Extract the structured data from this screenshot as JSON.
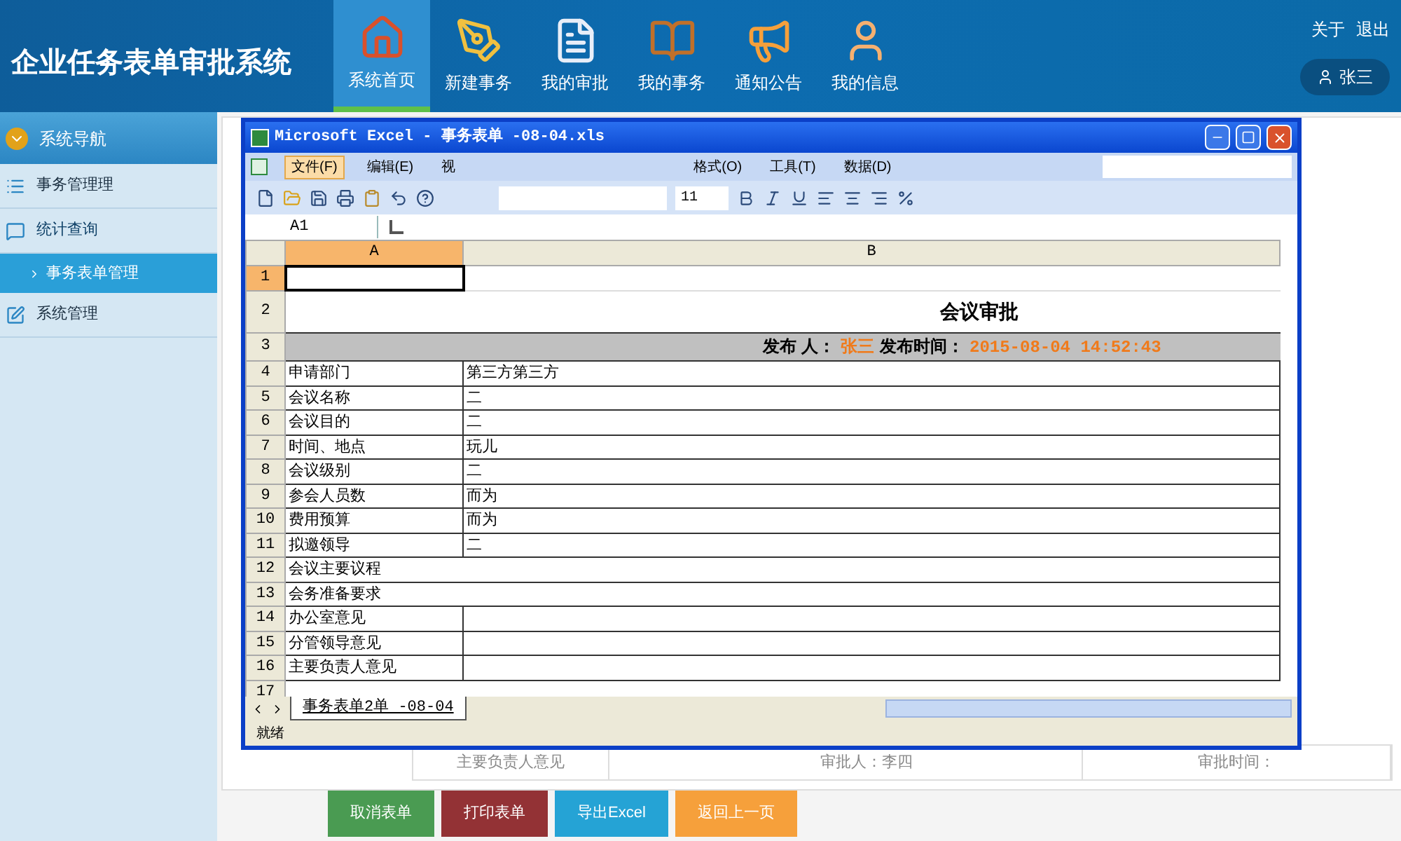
{
  "header": {
    "title": "企业任务表单审批系统",
    "nav": [
      {
        "label": "系统首页",
        "selected": true,
        "kind": "house"
      },
      {
        "label": "新建事务",
        "selected": false,
        "kind": "pencil"
      },
      {
        "label": "我的审批",
        "selected": false,
        "kind": "document"
      },
      {
        "label": "我的事务",
        "selected": false,
        "kind": "book"
      },
      {
        "label": "通知公告",
        "selected": false,
        "kind": "megaphone"
      },
      {
        "label": "我的信息",
        "selected": false,
        "kind": "person"
      }
    ],
    "links": [
      "关于",
      "退出"
    ],
    "user": "张三"
  },
  "sidebar": {
    "heading": "系统导航",
    "items": [
      {
        "label": "事务管理理",
        "kind": "list",
        "expanded": false
      },
      {
        "label": "统计查询",
        "kind": "chat",
        "expanded": true,
        "children": [
          {
            "label": "事务表单管理",
            "selected": true
          }
        ]
      },
      {
        "label": "系统管理",
        "kind": "edit",
        "expanded": false
      }
    ]
  },
  "excel": {
    "title": "Microsoft Excel - 事务表单   -08-04.xls",
    "menu": [
      {
        "label": "文件(F)",
        "selected": true
      },
      {
        "label": "编辑(E)",
        "selected": false
      },
      {
        "label": "视",
        "selected": false
      },
      {
        "label": "格式(O)",
        "selected": false
      },
      {
        "label": "工具(T)",
        "selected": false
      },
      {
        "label": "数据(D)",
        "selected": false
      }
    ],
    "font_size": "11",
    "name_box": "A1",
    "columns": [
      "A",
      "B"
    ],
    "rows": [
      {
        "n": "1",
        "kind": "blank",
        "selected": true
      },
      {
        "n": "2",
        "kind": "title",
        "text": "会议审批"
      },
      {
        "n": "3",
        "kind": "meta",
        "parts": [
          {
            "text": "发布 人：",
            "kind": "label"
          },
          {
            "text": "张三",
            "kind": "value"
          },
          {
            "text": "发布时间：",
            "kind": "label"
          },
          {
            "text": "2015-08-04 14:52:43",
            "kind": "value"
          }
        ]
      },
      {
        "n": "4",
        "kind": "pair",
        "a": "申请部门",
        "b": "第三方第三方"
      },
      {
        "n": "5",
        "kind": "pair",
        "a": "会议名称",
        "b": "二"
      },
      {
        "n": "6",
        "kind": "pair",
        "a": "会议目的",
        "b": "二"
      },
      {
        "n": "7",
        "kind": "pair",
        "a": "时间、地点",
        "b": "玩儿"
      },
      {
        "n": "8",
        "kind": "pair",
        "a": "会议级别",
        "b": "二"
      },
      {
        "n": "9",
        "kind": "pair",
        "a": "参会人员数",
        "b": "而为"
      },
      {
        "n": "10",
        "kind": "pair",
        "a": "费用预算",
        "b": "而为"
      },
      {
        "n": "11",
        "kind": "pair",
        "a": "拟邀领导",
        "b": "二"
      },
      {
        "n": "12",
        "kind": "wide",
        "a": "会议主要议程"
      },
      {
        "n": "13",
        "kind": "wide",
        "a": "会务准备要求"
      },
      {
        "n": "14",
        "kind": "pair",
        "a": "办公室意见"
      },
      {
        "n": "15",
        "kind": "pair",
        "a": "分管领导意见"
      },
      {
        "n": "16",
        "kind": "pair",
        "a": "主要负责人意见"
      },
      {
        "n": "17",
        "kind": "blank",
        "selected": false
      }
    ],
    "sheet_tab": "事务表单2单 -08-04",
    "status": "就绪"
  },
  "form_row": [
    "主要负责人意见",
    "审批人：李四",
    "审批时间："
  ],
  "buttons": [
    {
      "label": "取消表单",
      "color": "#4a9b52"
    },
    {
      "label": "打印表单",
      "color": "#933235"
    },
    {
      "label": "导出Excel",
      "color": "#25a3d5"
    },
    {
      "label": "返回上一页",
      "color": "#f6a03b"
    }
  ]
}
